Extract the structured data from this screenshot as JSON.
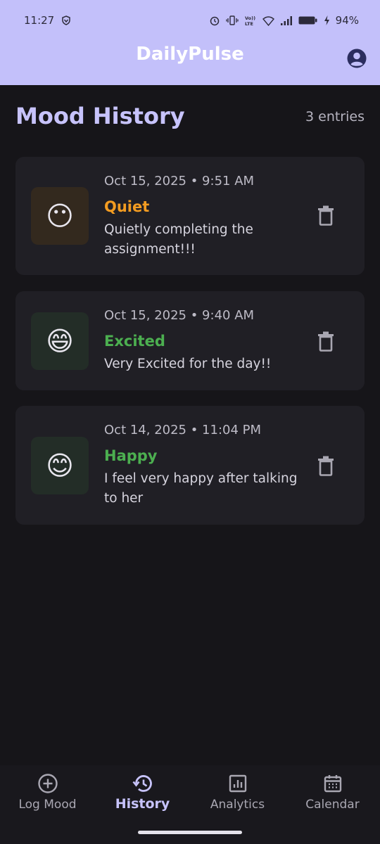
{
  "status_bar": {
    "time": "11:27",
    "battery": "94%"
  },
  "app": {
    "title": "DailyPulse"
  },
  "page": {
    "title": "Mood History",
    "entry_count": "3 entries"
  },
  "entries": [
    {
      "date": "Oct 15, 2025 • 9:51 AM",
      "mood": "Quiet",
      "emoji": "😶",
      "note": "Quietly completing the assignment!!!",
      "mood_color": "#f39c21",
      "emoji_bg": "#33291e"
    },
    {
      "date": "Oct 15, 2025 • 9:40 AM",
      "mood": "Excited",
      "emoji": "😄",
      "note": "Very Excited for the day!!",
      "mood_color": "#4caf50",
      "emoji_bg": "#232d27"
    },
    {
      "date": "Oct 14, 2025 • 11:04 PM",
      "mood": "Happy",
      "emoji": "😊",
      "note": "I feel very happy after talking to her",
      "mood_color": "#4caf50",
      "emoji_bg": "#232d27"
    }
  ],
  "bottom_nav": {
    "items": [
      {
        "label": "Log Mood",
        "icon": "plus-circle-icon",
        "active": false
      },
      {
        "label": "History",
        "icon": "history-icon",
        "active": true
      },
      {
        "label": "Analytics",
        "icon": "analytics-icon",
        "active": false
      },
      {
        "label": "Calendar",
        "icon": "calendar-icon",
        "active": false
      }
    ]
  },
  "colors": {
    "header_bg": "#c3c0fa",
    "accent": "#c7c3fb",
    "background": "#161519",
    "card_bg": "#201f25"
  }
}
